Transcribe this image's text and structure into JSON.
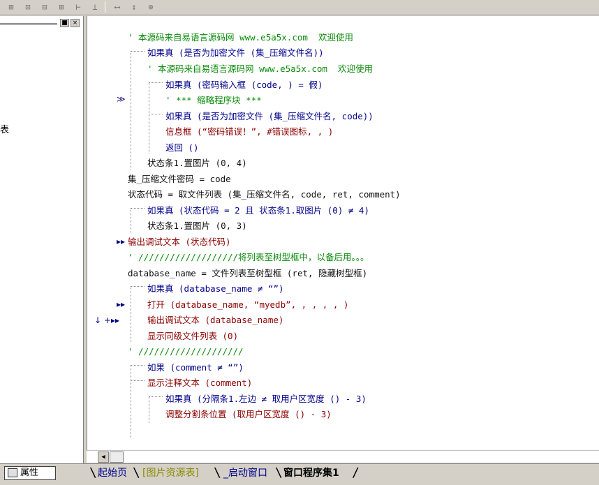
{
  "toolbar": {
    "icons": [
      "align-left-icon",
      "align-top-icon",
      "align-center-icon",
      "align-right-icon",
      "distribute-horizontal-icon",
      "distribute-vertical-icon",
      "same-width-icon",
      "same-height-icon",
      "same-size-icon"
    ]
  },
  "left_panel": {
    "pin_label": "■",
    "close_label": "×",
    "partial_text": "表"
  },
  "code": {
    "lines": [
      {
        "text": "' 本源码来自易语言源码网 www.e5a5x.com  欢迎使用",
        "color": "green"
      },
      {
        "text": "如果真 (是否为加密文件 (集_压缩文件名))",
        "color": "blue"
      },
      {
        "text": "' 本源码来自易语言源码网 www.e5a5x.com  欢迎使用",
        "color": "green"
      },
      {
        "text": "如果真 (密码输入框 (code, ) = 假)",
        "color": "blue"
      },
      {
        "text": "' *** 缩略程序块 ***",
        "color": "green"
      },
      {
        "text": "如果真 (是否为加密文件 (集_压缩文件名, code))",
        "color": "blue"
      },
      {
        "text": "信息框 (“密码错误！”, #错误图标, , )",
        "color": "red"
      },
      {
        "text": "返回 ()",
        "color": "blue"
      },
      {
        "text": "状态条1.置图片 (0, 4)",
        "color": "black"
      },
      {
        "text": "集_压缩文件密码 = code",
        "color": "black"
      },
      {
        "text": "状态代码 = 取文件列表 (集_压缩文件名, code, ret, comment)",
        "color": "black"
      },
      {
        "text": "如果真 (状态代码 = 2 且 状态条1.取图片 (0) ≠ 4)",
        "color": "blue"
      },
      {
        "text": "状态条1.置图片 (0, 3)",
        "color": "black"
      },
      {
        "text": "输出调试文本 (状态代码)",
        "color": "red"
      },
      {
        "text": "' ///////////////////将列表至树型框中，以备后用。。。",
        "color": "green"
      },
      {
        "text": "database_name = 文件列表至树型框 (ret, 隐藏树型框)",
        "color": "black"
      },
      {
        "text": "如果真 (database_name ≠ “”)",
        "color": "blue"
      },
      {
        "text": "打开 (database_name, “myedb”, , , , , )",
        "color": "red"
      },
      {
        "text": "输出调试文本 (database_name)",
        "color": "red"
      },
      {
        "text": "显示同级文件列表 (0)",
        "color": "red"
      },
      {
        "text": "' ////////////////////",
        "color": "green"
      },
      {
        "text": "如果 (comment ≠ “”)",
        "color": "blue"
      },
      {
        "text": "显示注释文本 (comment)",
        "color": "red"
      },
      {
        "text": "如果真 (分隔条1.左边 ≠ 取用户区宽度 () - 3)",
        "color": "blue"
      },
      {
        "text": "调整分割条位置 (取用户区宽度 () - 3)",
        "color": "red"
      }
    ]
  },
  "gutter_markers": [
    {
      "symbol": "≫",
      "name": "collapsed-block-marker"
    },
    {
      "symbol": "▸▸",
      "name": "breakpoint-arrow-marker"
    },
    {
      "symbol": "▸▸",
      "name": "breakpoint-arrow-marker"
    },
    {
      "symbol": "↓ +▸▸",
      "name": "current-line-marker"
    }
  ],
  "scroll": {
    "left_arrow": "◀"
  },
  "bottom": {
    "properties_label": "属性",
    "tabs": [
      {
        "label": "起始页",
        "active": false,
        "color": "#00008b"
      },
      {
        "label": "[图片资源表]",
        "active": false,
        "color": "#8a8a00"
      },
      {
        "label": "_启动窗口",
        "active": false,
        "color": "#00008b"
      },
      {
        "label": "窗口程序集1",
        "active": true,
        "color": "#000000"
      }
    ]
  }
}
